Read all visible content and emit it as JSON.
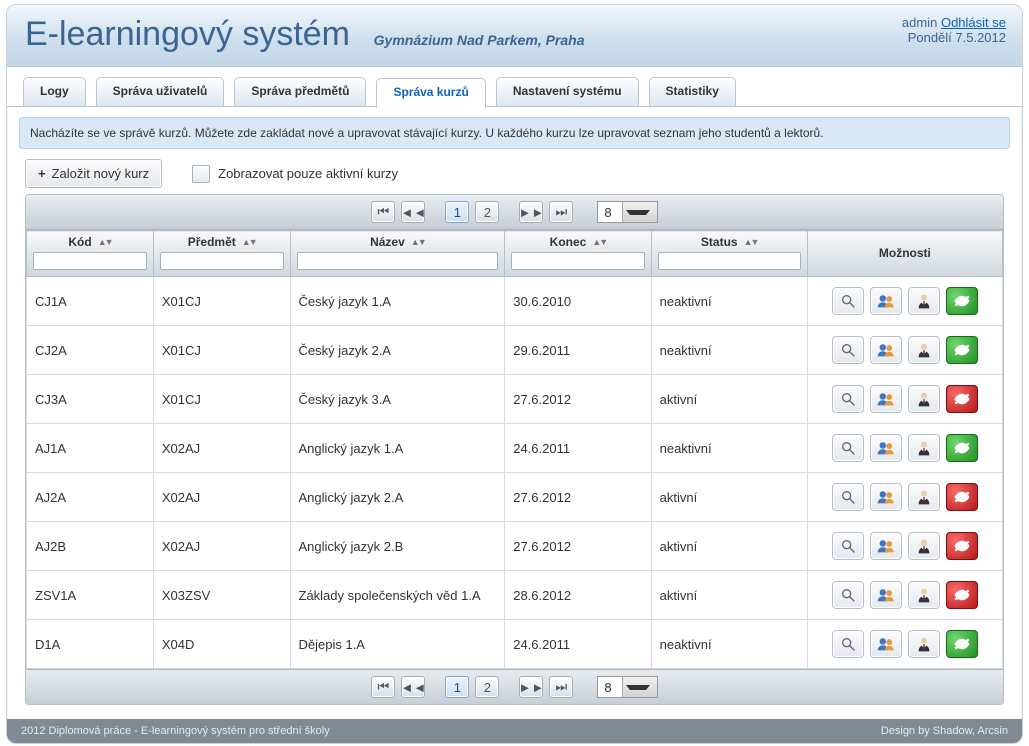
{
  "header": {
    "title": "E-learningový systém",
    "subtitle": "Gymnázium Nad Parkem, Praha",
    "user": "admin",
    "logout": "Odhlásit se",
    "date": "Pondělí 7.5.2012"
  },
  "tabs": [
    {
      "label": "Logy",
      "active": false
    },
    {
      "label": "Správa uživatelů",
      "active": false
    },
    {
      "label": "Správa předmětů",
      "active": false
    },
    {
      "label": "Správa kurzů",
      "active": true
    },
    {
      "label": "Nastavení systému",
      "active": false
    },
    {
      "label": "Statistiky",
      "active": false
    }
  ],
  "info": "Nacházíte se ve správě kurzů. Můžete zde zakládat nové a upravovat stávající kurzy. U každého kurzu lze upravovat seznam jeho studentů a lektorů.",
  "toolbar": {
    "new_course": "Založit nový kurz",
    "only_active": "Zobrazovat pouze aktivní kurzy"
  },
  "pager": {
    "pages": [
      "1",
      "2"
    ],
    "current": "1",
    "page_size": "8"
  },
  "columns": {
    "code": "Kód",
    "subject": "Předmět",
    "name": "Název",
    "end": "Konec",
    "status": "Status",
    "actions": "Možnosti"
  },
  "rows": [
    {
      "code": "CJ1A",
      "subject": "X01CJ",
      "name": "Český jazyk 1.A",
      "end": "30.6.2010",
      "status": "neaktivní",
      "rowstate": "green"
    },
    {
      "code": "CJ2A",
      "subject": "X01CJ",
      "name": "Český jazyk 2.A",
      "end": "29.6.2011",
      "status": "neaktivní",
      "rowstate": "green"
    },
    {
      "code": "CJ3A",
      "subject": "X01CJ",
      "name": "Český jazyk 3.A",
      "end": "27.6.2012",
      "status": "aktivní",
      "rowstate": "red"
    },
    {
      "code": "AJ1A",
      "subject": "X02AJ",
      "name": "Anglický jazyk 1.A",
      "end": "24.6.2011",
      "status": "neaktivní",
      "rowstate": "green"
    },
    {
      "code": "AJ2A",
      "subject": "X02AJ",
      "name": "Anglický jazyk 2.A",
      "end": "27.6.2012",
      "status": "aktivní",
      "rowstate": "red"
    },
    {
      "code": "AJ2B",
      "subject": "X02AJ",
      "name": "Anglický jazyk 2.B",
      "end": "27.6.2012",
      "status": "aktivní",
      "rowstate": "red"
    },
    {
      "code": "ZSV1A",
      "subject": "X03ZSV",
      "name": "Základy společenských věd 1.A",
      "end": "28.6.2012",
      "status": "aktivní",
      "rowstate": "red"
    },
    {
      "code": "D1A",
      "subject": "X04D",
      "name": "Dějepis 1.A",
      "end": "24.6.2011",
      "status": "neaktivní",
      "rowstate": "green"
    }
  ],
  "footer": {
    "left": "2012 Diplomová práce - E-learningový systém pro střední školy",
    "right": "Design by Shadow, Arcsin"
  }
}
